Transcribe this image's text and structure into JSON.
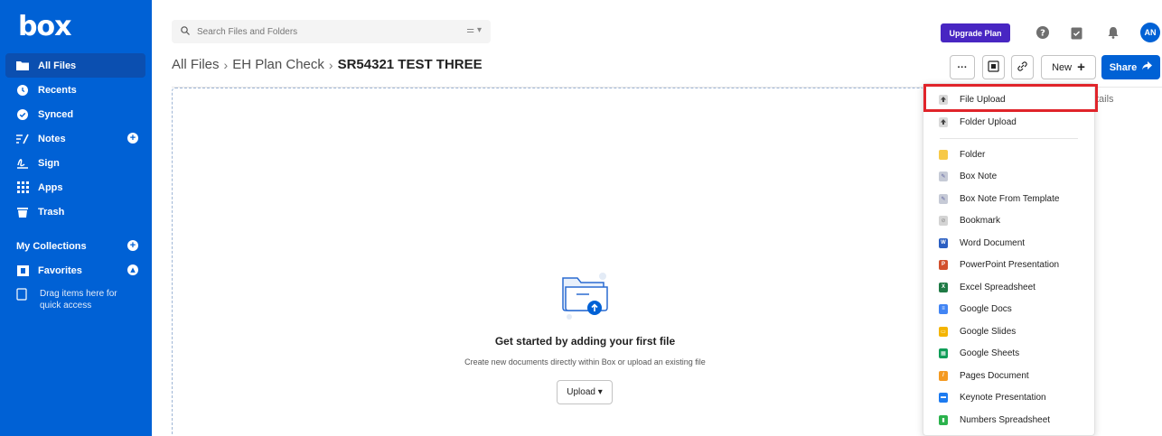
{
  "sidebar": {
    "logo": "box",
    "items": [
      {
        "label": "All Files"
      },
      {
        "label": "Recents"
      },
      {
        "label": "Synced"
      },
      {
        "label": "Notes"
      },
      {
        "label": "Sign"
      },
      {
        "label": "Apps"
      },
      {
        "label": "Trash"
      }
    ],
    "collections_label": "My Collections",
    "favorites_label": "Favorites",
    "drag_hint": "Drag items here for quick access"
  },
  "topbar": {
    "search_placeholder": "Search Files and Folders",
    "upgrade_label": "Upgrade Plan",
    "avatar_initials": "AN"
  },
  "breadcrumb": {
    "items": [
      "All Files",
      "EH Plan Check"
    ],
    "separator": "›",
    "current": "SR54321 TEST THREE"
  },
  "header": {
    "more_label": "···",
    "new_label": "New",
    "share_label": "Share",
    "details_label": "tails"
  },
  "empty_state": {
    "title": "Get started by adding your first file",
    "subtitle": "Create new documents directly within Box or upload an existing file",
    "upload_label": "Upload ▾"
  },
  "new_menu": {
    "items": [
      {
        "label": "File Upload",
        "icon": "upload-icon",
        "color": "#5a5a5a"
      },
      {
        "label": "Folder Upload",
        "icon": "folder-upload-icon",
        "color": "#5a5a5a"
      },
      {
        "label": "Folder",
        "icon": "folder-icon",
        "color": "#f7c948"
      },
      {
        "label": "Box Note",
        "icon": "box-note-icon",
        "color": "#b9bdc7"
      },
      {
        "label": "Box Note From Template",
        "icon": "box-note-template-icon",
        "color": "#b9bdc7"
      },
      {
        "label": "Bookmark",
        "icon": "bookmark-icon",
        "color": "#c9c9c9"
      },
      {
        "label": "Word Document",
        "icon": "word-icon",
        "color": "#2b5fc2"
      },
      {
        "label": "PowerPoint Presentation",
        "icon": "powerpoint-icon",
        "color": "#d2502e"
      },
      {
        "label": "Excel Spreadsheet",
        "icon": "excel-icon",
        "color": "#1f7a45"
      },
      {
        "label": "Google Docs",
        "icon": "google-docs-icon",
        "color": "#4285f4"
      },
      {
        "label": "Google Slides",
        "icon": "google-slides-icon",
        "color": "#f4b400"
      },
      {
        "label": "Google Sheets",
        "icon": "google-sheets-icon",
        "color": "#0f9d58"
      },
      {
        "label": "Pages Document",
        "icon": "pages-icon",
        "color": "#f49a22"
      },
      {
        "label": "Keynote Presentation",
        "icon": "keynote-icon",
        "color": "#1d7bf0"
      },
      {
        "label": "Numbers Spreadsheet",
        "icon": "numbers-icon",
        "color": "#2bb24c"
      }
    ]
  }
}
